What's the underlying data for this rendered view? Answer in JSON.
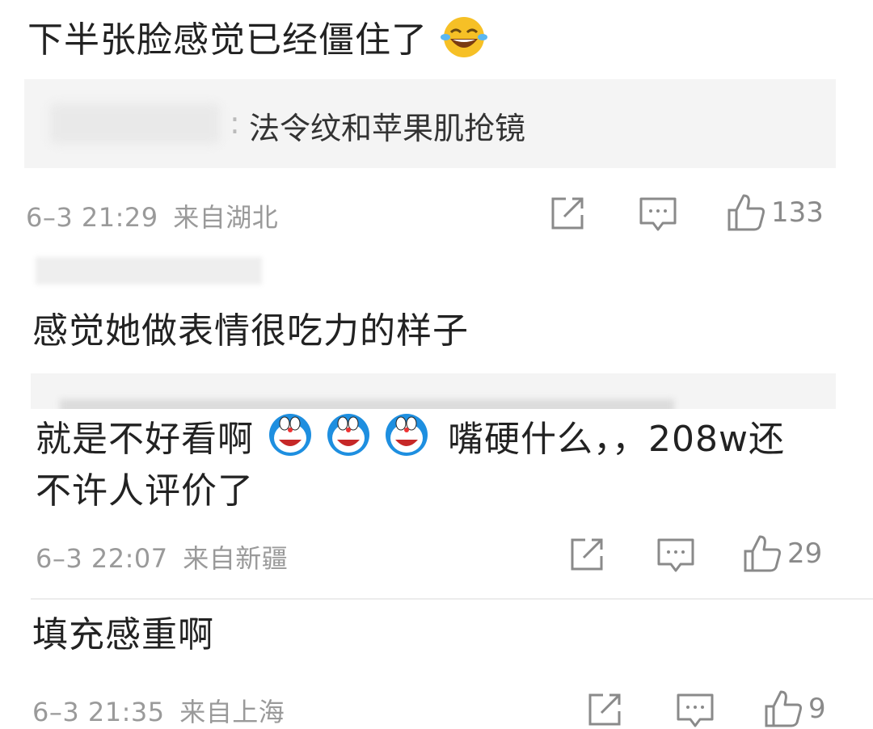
{
  "comments": [
    {
      "text": "下半张脸感觉已经僵住了",
      "emoji": "laughing-tears-emoji",
      "reply": {
        "author": "",
        "sep": ":",
        "text": "法令纹和苹果肌抢镜"
      },
      "date": "6–3 21:29",
      "location": "来自湖北",
      "likes": "133"
    },
    {
      "author_blurred": "",
      "text": "感觉她做表情很吃力的样子",
      "reply_partial": "",
      "date": "",
      "location": ""
    },
    {
      "text_a": "就是不好看啊",
      "emoji": "doraemon-emoji",
      "text_b": "嘴硬什么，，208w还",
      "text_c": "不许人评价了",
      "date": "6–3 22:07",
      "location": "来自新疆",
      "likes": "29"
    },
    {
      "text": "填充感重啊",
      "date": "6–3 21:35",
      "location": "来自上海",
      "likes": "9"
    }
  ],
  "colors": {
    "meta": "#9a9a9a",
    "reply_bg": "#f4f4f4",
    "emoji_yellow": "#f6c026",
    "doraemon_blue": "#1e8fe0"
  }
}
